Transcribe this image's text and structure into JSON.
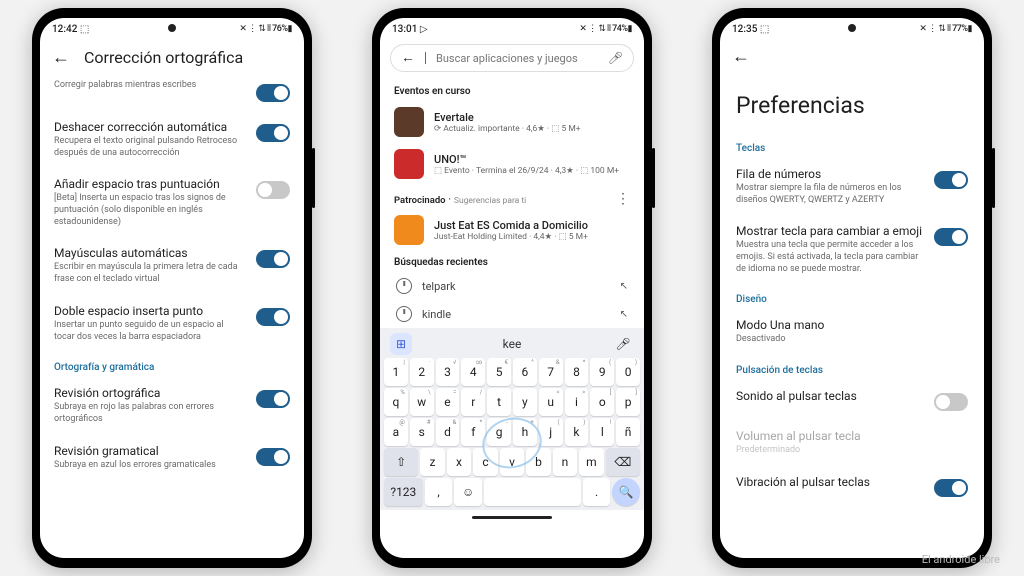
{
  "phone1": {
    "status": {
      "time": "12:42",
      "icons": "⬚",
      "right": "✕ ⋮ ⇅ ⫴ 76%▮"
    },
    "title": "Corrección ortográfica",
    "items": [
      {
        "title": "",
        "desc": "Corregir palabras mientras escribes",
        "on": true
      },
      {
        "title": "Deshacer corrección automática",
        "desc": "Recupera el texto original pulsando Retroceso después de una autocorrección",
        "on": true
      },
      {
        "title": "Añadir espacio tras puntuación",
        "desc": "[Beta] Inserta un espacio tras los signos de puntuación (solo disponible en inglés estadounidense)",
        "on": false
      },
      {
        "title": "Mayúsculas automáticas",
        "desc": "Escribir en mayúscula la primera letra de cada frase con el teclado virtual",
        "on": true
      },
      {
        "title": "Doble espacio inserta punto",
        "desc": "Insertar un punto seguido de un espacio al tocar dos veces la barra espaciadora",
        "on": true
      }
    ],
    "section": "Ortografía y gramática",
    "items2": [
      {
        "title": "Revisión ortográfica",
        "desc": "Subraya en rojo las palabras con errores ortográficos",
        "on": true
      },
      {
        "title": "Revisión gramatical",
        "desc": "Subraya en azul los errores gramaticales",
        "on": true
      }
    ]
  },
  "phone2": {
    "status": {
      "time": "13:01",
      "icons": "▷",
      "right": "✕ ⋮ ⇅ ⫴ 74%▮"
    },
    "search_placeholder": "Buscar aplicaciones y juegos",
    "sec1": "Eventos en curso",
    "apps": [
      {
        "name": "Evertale",
        "sub": "⟳ Actualiz. importante · 4,6★ · ⬚ 5 M+",
        "color": "#5b3a2a"
      },
      {
        "name": "UNO!™",
        "sub": "⬚ Evento · Termina el 26/9/24 · 4,3★ · ⬚ 100 M+",
        "color": "#cc2b2b"
      }
    ],
    "sponsor_label": "Patrocinado",
    "sponsor_hint": "Sugerencias para ti",
    "sponsored": {
      "name": "Just Eat ES Comida a Domicilio",
      "sub": "Just-Eat Holding Limited · 4,4★ · ⬚ 5 M+",
      "color": "#f18a1c"
    },
    "sec2": "Búsquedas recientes",
    "recents": [
      "telpark",
      "kindle"
    ],
    "suggestion": "kee",
    "kb_numbers_sup": [
      "|",
      "·",
      "√",
      "∞",
      "€",
      "^",
      "&",
      "*",
      "(",
      ")"
    ],
    "kb_row1": [
      "1",
      "2",
      "3",
      "4",
      "5",
      "6",
      "7",
      "8",
      "9",
      "0"
    ],
    "kb_row2": [
      "q",
      "w",
      "e",
      "r",
      "t",
      "y",
      "u",
      "i",
      "o",
      "p"
    ],
    "kb_row2_sup": [
      "%",
      "\\",
      "=",
      "/",
      "",
      "",
      "<",
      ">",
      "[",
      "]"
    ],
    "kb_row3": [
      "a",
      "s",
      "d",
      "f",
      "g",
      "h",
      "j",
      "k",
      "l",
      "ñ"
    ],
    "kb_row3_sup": [
      "@",
      "#",
      "&",
      "*",
      "-",
      "+",
      "(",
      ")",
      "!",
      ""
    ],
    "kb_row4": [
      "⇧",
      "z",
      "x",
      "c",
      "v",
      "b",
      "n",
      "m",
      "⌫"
    ],
    "kb_row5": [
      "?123",
      ",",
      "☺",
      " ",
      ".",
      "🔍"
    ]
  },
  "phone3": {
    "status": {
      "time": "12:35",
      "icons": "⬚",
      "right": "✕ ⋮ ⇅ ⫴ 77%▮"
    },
    "title": "Preferencias",
    "sec_teclas": "Teclas",
    "items": [
      {
        "title": "Fila de números",
        "desc": "Mostrar siempre la fila de números en los diseños QWERTY, QWERTZ y AZERTY",
        "on": true
      },
      {
        "title": "Mostrar tecla para cambiar a emoji",
        "desc": "Muestra una tecla que permite acceder a los emojis. Si está activada, la tecla para cambiar de idioma no se puede mostrar.",
        "on": true
      }
    ],
    "sec_diseno": "Diseño",
    "modo": {
      "title": "Modo Una mano",
      "desc": "Desactivado"
    },
    "sec_puls": "Pulsación de teclas",
    "sonido": {
      "title": "Sonido al pulsar teclas",
      "on": false
    },
    "volumen": {
      "title": "Volumen al pulsar tecla",
      "desc": "Predeterminado"
    },
    "vibracion": {
      "title": "Vibración al pulsar teclas",
      "on": true
    }
  },
  "watermark": "El androide libre"
}
